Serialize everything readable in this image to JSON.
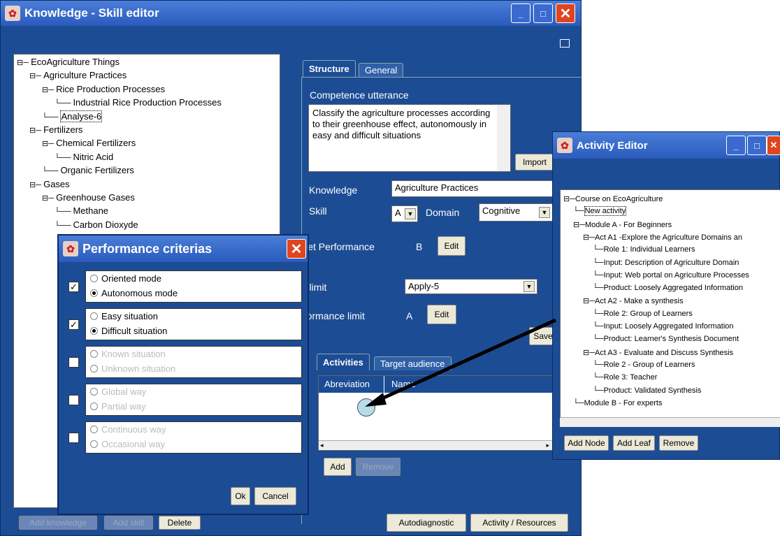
{
  "skill_editor": {
    "title": "Knowledge - Skill editor",
    "tree": [
      {
        "label": "EcoAgriculture Things",
        "exp": "⊟"
      },
      {
        "label": "Agriculture Practices",
        "exp": "⊟"
      },
      {
        "label": "Rice Production Processes",
        "exp": "⊟"
      },
      {
        "label": "Industrial Rice Production Processes",
        "exp": ""
      },
      {
        "label": "Analyse-6",
        "exp": ""
      },
      {
        "label": "Fertilizers",
        "exp": "⊟"
      },
      {
        "label": "Chemical Fertilizers",
        "exp": "⊟"
      },
      {
        "label": "Nitric Acid",
        "exp": ""
      },
      {
        "label": "Organic Fertilizers",
        "exp": ""
      },
      {
        "label": "Gases",
        "exp": "⊟"
      },
      {
        "label": "Greenhouse Gases",
        "exp": "⊟"
      },
      {
        "label": "Methane",
        "exp": ""
      },
      {
        "label": "Carbon Dioxyde",
        "exp": ""
      }
    ],
    "tabs": {
      "structure": "Structure",
      "general": "General"
    },
    "competence_label": "Competence utterance",
    "competence_text": "Classify the agriculture processes according to their greenhouse effect, autonomously in easy and difficult situations",
    "import_label": "Import",
    "knowledge_label": "Knowledge",
    "knowledge_value": "Agriculture Practices",
    "skill_label": "Skill",
    "skill_value": "A",
    "domain_label": "Domain",
    "domain_value": "Cognitive",
    "target_perf_label": "Target Performance",
    "target_perf_value": "B",
    "edit_label": "Edit",
    "skill_limit_label": "Skill limit",
    "skill_limit_value": "Apply-5",
    "perf_limit_label": "Performance limit",
    "perf_limit_value": "A",
    "save_label": "Save",
    "act_tabs": {
      "activities": "Activities",
      "target": "Target audience"
    },
    "columns": [
      "Abreviation",
      "Name"
    ],
    "add_label": "Add",
    "remove_label": "Remove",
    "add_knowledge": "Add knowledge",
    "add_skill": "Add skill",
    "delete": "Delete",
    "autodiagnostic": "Autodiagnostic",
    "activity_resources": "Activity / Resources"
  },
  "perf_dialog": {
    "title": "Performance criterias",
    "groups": [
      {
        "checked": true,
        "opt1": "Oriented mode",
        "opt2": "Autonomous mode",
        "sel": 2,
        "enabled": true
      },
      {
        "checked": true,
        "opt1": "Easy situation",
        "opt2": "Difficult situation",
        "sel": 2,
        "enabled": true
      },
      {
        "checked": false,
        "opt1": "Known situation",
        "opt2": "Unknown situation",
        "sel": 0,
        "enabled": false
      },
      {
        "checked": false,
        "opt1": "Global way",
        "opt2": "Partial way",
        "sel": 0,
        "enabled": false
      },
      {
        "checked": false,
        "opt1": "Continuous way",
        "opt2": "Occasional way",
        "sel": 0,
        "enabled": false
      }
    ],
    "ok": "Ok",
    "cancel": "Cancel"
  },
  "activity_editor": {
    "title": "Activity Editor",
    "tree": [
      "Course on EcoAgriculture",
      "New activity",
      "Module A - For Beginners",
      "Act A1 -Explore the Agriculture Domains an",
      "Role 1: Individual Learners",
      "Input: Description of Agriculture Domain",
      "Input: Web portal on Agriculture Processes",
      "Product: Loosely Aggregated Information",
      "Act  A2 - Make a synthesis",
      "Role 2: Group of Learners",
      "Input: Loosely Aggregated Information",
      "Product: Learner's Synthesis Document",
      "Act A3 - Evaluate and Discuss Synthesis",
      "Role 2 - Group of Learners",
      "Role 3: Teacher",
      "Product: Validated Synthesis",
      "Module B  - For experts"
    ],
    "add_node": "Add Node",
    "add_leaf": "Add Leaf",
    "remove": "Remove"
  },
  "colors": {
    "window_bg": "#1c4c94",
    "title_bg": "#2a5bbd",
    "close_btn": "#e0451f"
  }
}
